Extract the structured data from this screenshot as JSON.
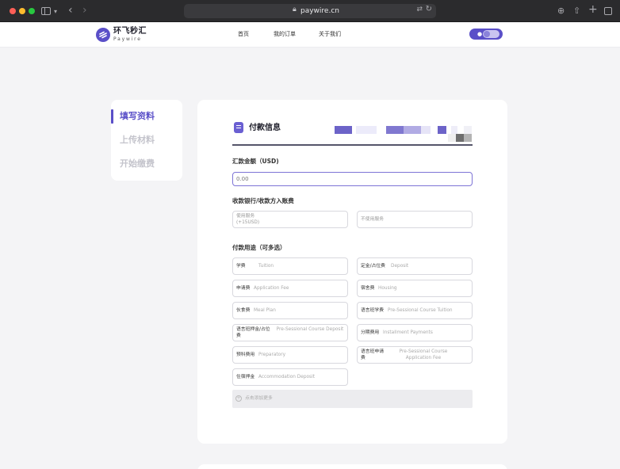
{
  "browser": {
    "url": "paywire.cn"
  },
  "site": {
    "logo_cn": "环飞秒汇",
    "logo_en": "Paywire",
    "nav": [
      "首页",
      "我的订单",
      "关于我们"
    ],
    "brand_color": "#5a4fc8"
  },
  "steps": [
    "填写资料",
    "上传材料",
    "开始缴费"
  ],
  "form": {
    "title": "付款信息",
    "amount_label": "汇款金额（USD)",
    "amount_placeholder": "0.00",
    "bank_fee_label": "收款银行/收款方入账费",
    "bank_fee_options": [
      {
        "line1": "使用服务",
        "line2": "(+15USD)"
      },
      {
        "line1": "不使用服务",
        "line2": ""
      }
    ],
    "purpose_label": "付款用途（可多选）",
    "purposes": [
      {
        "cn": "学费",
        "en": "Tuition"
      },
      {
        "cn": "定金/占位费",
        "en": "Deposit"
      },
      {
        "cn": "申请费",
        "en": "Application Fee"
      },
      {
        "cn": "宿舍费",
        "en": "Housing"
      },
      {
        "cn": "伙食费",
        "en": "Meal Plan"
      },
      {
        "cn": "语言班学费",
        "en": "Pre-Sessional Course Tuition"
      },
      {
        "cn": "语言班押金/占位费",
        "en": "Pre-Sessional Course Deposit"
      },
      {
        "cn": "分期费用",
        "en": "Installment Payments"
      },
      {
        "cn": "预科费用",
        "en": "Preparatory"
      },
      {
        "cn": "语言班申请费",
        "en": "Pre-Sessional Course Application Fee"
      },
      {
        "cn": "住宿押金",
        "en": "Accommodation Deposit"
      }
    ],
    "add_more": "点击添加更多"
  }
}
